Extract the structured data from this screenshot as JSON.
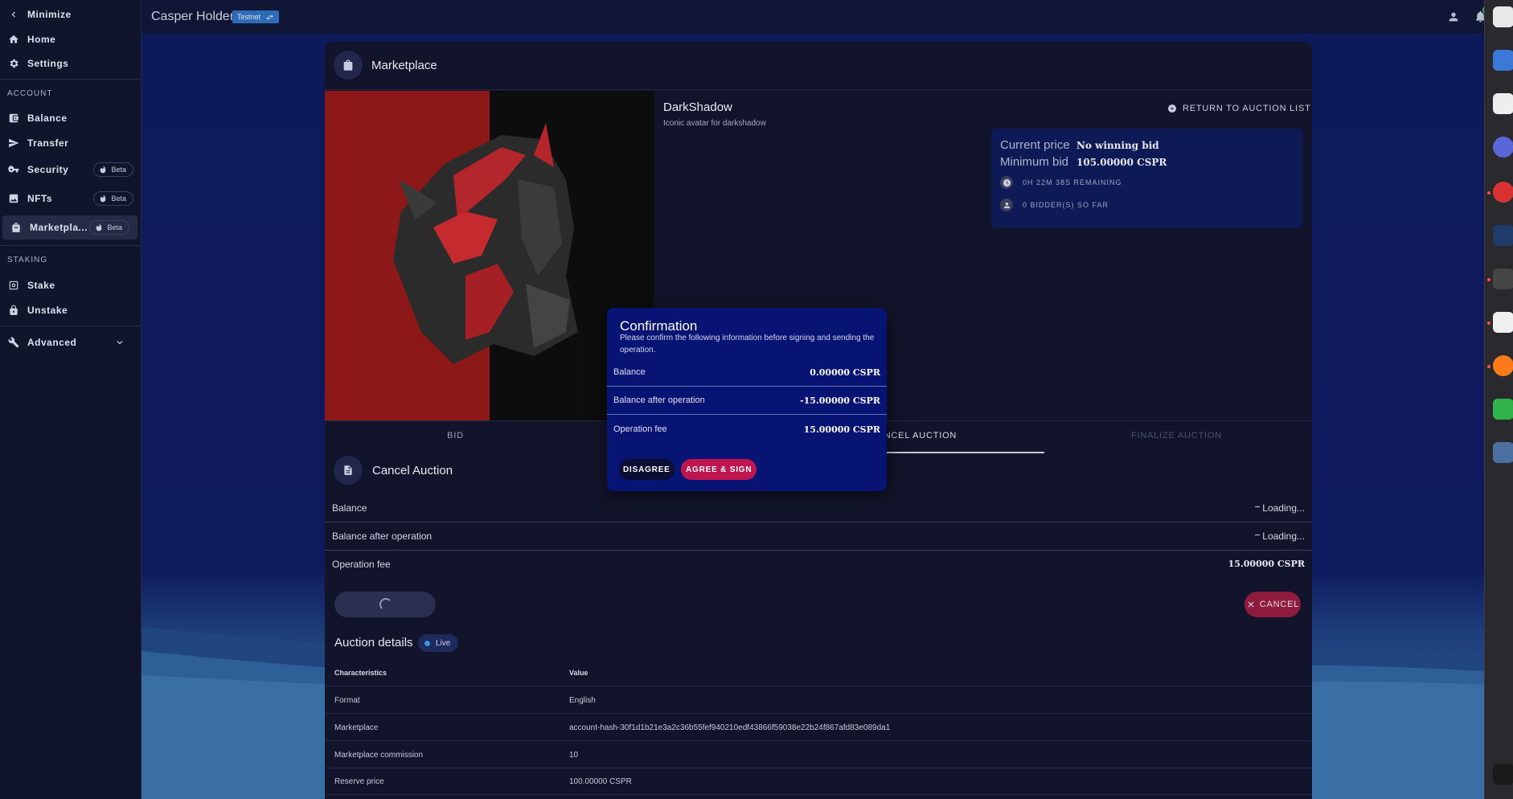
{
  "sidebar": {
    "minimize": "Minimize",
    "home": "Home",
    "settings": "Settings",
    "account_section": "ACCOUNT",
    "balance": "Balance",
    "transfer": "Transfer",
    "security": "Security",
    "nfts": "NFTs",
    "marketplace": "Marketpla...",
    "beta": "Beta",
    "staking_section": "STAKING",
    "stake": "Stake",
    "unstake": "Unstake",
    "advanced": "Advanced"
  },
  "topbar": {
    "brand": "Casper Holders",
    "network": "Testnet",
    "notifications": "0"
  },
  "card": {
    "title": "Marketplace",
    "nft_name": "DarkShadow",
    "nft_description": "Iconic avatar for darkshadow",
    "return_label": "RETURN TO AUCTION LIST",
    "current_price_label": "Current price",
    "current_price_value": "No winning bid",
    "minimum_bid_label": "Minimum bid",
    "minimum_bid_value": "105.00000 CSPR",
    "remaining": "0H 22M 38S REMAINING",
    "bidders": "0 BIDDER(S) SO FAR"
  },
  "tabs": [
    "BID",
    "CANCEL AUCTION",
    "FINALIZE AUCTION"
  ],
  "cancel_section": {
    "title": "Cancel Auction",
    "rows": [
      {
        "label": "Balance",
        "value": "Loading..."
      },
      {
        "label": "Balance after operation",
        "value": "Loading..."
      },
      {
        "label": "Operation fee",
        "value": "15.00000 CSPR"
      }
    ],
    "cancel_label": "CANCEL"
  },
  "auction_details": {
    "title": "Auction details",
    "status": "Live",
    "headers": [
      "Characteristics",
      "Value"
    ],
    "rows": [
      [
        "Format",
        "English"
      ],
      [
        "Marketplace",
        "account-hash-30f1d1b21e3a2c36b55fef940210edf43866f59038e22b24f867afd83e089da1"
      ],
      [
        "Marketplace commission",
        "10"
      ],
      [
        "Reserve price",
        "100.00000 CSPR"
      ]
    ]
  },
  "modal": {
    "title": "Confirmation",
    "subtitle": "Please confirm the following information before signing and sending the operation.",
    "rows": [
      {
        "label": "Balance",
        "value": "0.00000 CSPR"
      },
      {
        "label": "Balance after operation",
        "value": "-15.00000 CSPR"
      },
      {
        "label": "Operation fee",
        "value": "15.00000 CSPR"
      }
    ],
    "disagree": "DISAGREE",
    "agree": "AGREE & SIGN"
  },
  "colors": {
    "accent_pink": "#c01650",
    "modal_bg": "#081474",
    "testnet_badge": "#2e6bb8"
  }
}
